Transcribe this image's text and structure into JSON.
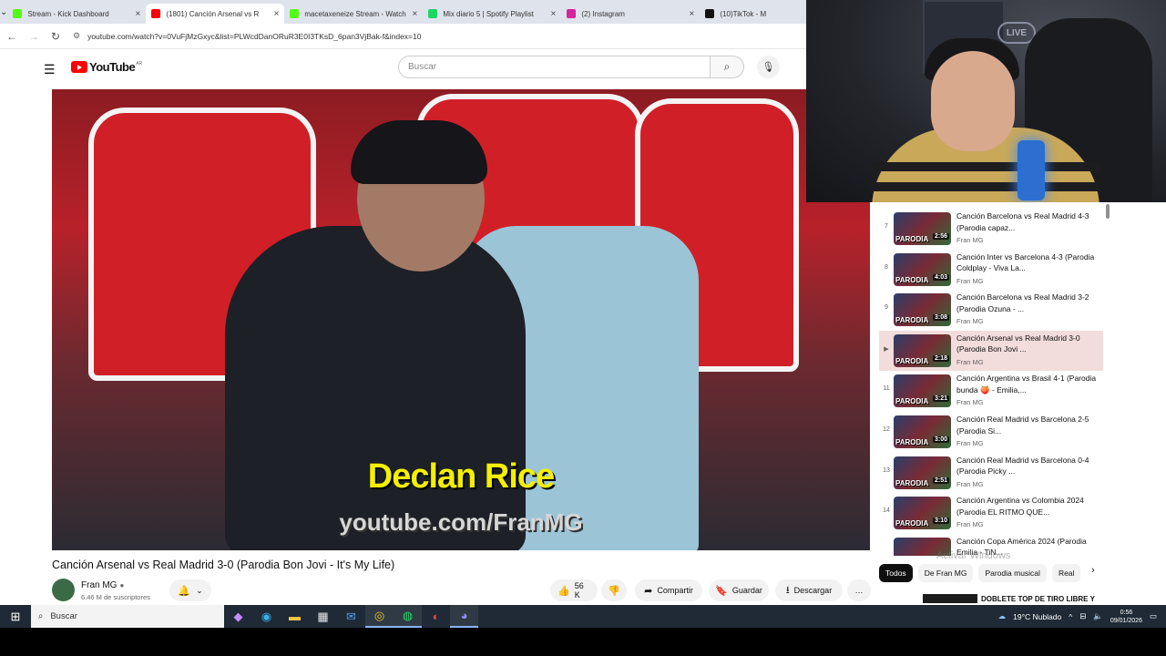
{
  "browser": {
    "tabs": [
      {
        "title": "Stream - Kick Dashboard",
        "color": "#53fc18",
        "active": false
      },
      {
        "title": "(1801) Canción Arsenal vs R",
        "color": "#ff0000",
        "active": true
      },
      {
        "title": "macetaxeneize Stream - Watch",
        "color": "#53fc18",
        "active": false
      },
      {
        "title": "Mix diario 5 | Spotify Playlist",
        "color": "#1ed760",
        "active": false
      },
      {
        "title": "(2) Instagram",
        "color": "#d6249f",
        "active": false
      },
      {
        "title": "(10)TikTok - M",
        "color": "#111111",
        "active": false
      }
    ],
    "url": "youtube.com/watch?v=0VuFjMzGxyc&list=PLWcdDanORuR3E0I3TKsD_6pan3VjBak-f&index=10"
  },
  "youtube": {
    "logo_text": "YouTube",
    "country": "AR",
    "search_placeholder": "Buscar"
  },
  "video": {
    "caption": "Declan Rice",
    "watermark": "youtube.com/FranMG",
    "title": "Canción Arsenal vs Real Madrid 3-0 (Parodia Bon Jovi - It's My Life)",
    "channel": "Fran MG",
    "subscribers": "6.46 M de suscriptores",
    "likes": "56 K",
    "share": "Compartir",
    "save": "Guardar",
    "download": "Descargar",
    "more": "…"
  },
  "playlist": {
    "items": [
      {
        "index": "7",
        "title": "Canción Barcelona vs Real Madrid 4-3 (Parodia capaz...",
        "channel": "Fran MG",
        "duration": "2:56",
        "current": false
      },
      {
        "index": "8",
        "title": "Canción Inter vs Barcelona 4-3 (Parodia Coldplay - Viva La...",
        "channel": "Fran MG",
        "duration": "4:03",
        "current": false
      },
      {
        "index": "9",
        "title": "Canción Barcelona vs Real Madrid 3-2 (Parodia Ozuna - ...",
        "channel": "Fran MG",
        "duration": "3:08",
        "current": false
      },
      {
        "index": "▶",
        "title": "Canción Arsenal vs Real Madrid 3-0 (Parodia Bon Jovi ...",
        "channel": "Fran MG",
        "duration": "2:18",
        "current": true
      },
      {
        "index": "11",
        "title": "Canción Argentina vs Brasil 4-1 (Parodia bunda 🍑 - Emilia,...",
        "channel": "Fran MG",
        "duration": "3:21",
        "current": false
      },
      {
        "index": "12",
        "title": "Canción Real Madrid vs Barcelona 2-5 (Parodia Si...",
        "channel": "Fran MG",
        "duration": "3:00",
        "current": false
      },
      {
        "index": "13",
        "title": "Canción Real Madrid vs Barcelona 0-4 (Parodia Picky ...",
        "channel": "Fran MG",
        "duration": "2:51",
        "current": false
      },
      {
        "index": "14",
        "title": "Canción Argentina vs Colombia 2024 (Parodia EL RITMO QUE...",
        "channel": "Fran MG",
        "duration": "3:10",
        "current": false
      },
      {
        "index": "",
        "title": "Canción Copa América 2024 (Parodia Emilia - TiN...",
        "channel": "Fran MG",
        "duration": "",
        "current": false
      }
    ],
    "thumb_label": "PARODIA"
  },
  "chips": [
    "Todos",
    "De Fran MG",
    "Parodia musical",
    "Real"
  ],
  "activate_windows": "Activar Windows",
  "recommended_peek": "DOBLETE TOP DE TIRO LIBRE Y",
  "webcam": {
    "live_sign": "LIVE"
  },
  "taskbar": {
    "search": "Buscar",
    "weather": "19°C  Nublado",
    "time": "0:56",
    "date": "09/01/2026"
  }
}
